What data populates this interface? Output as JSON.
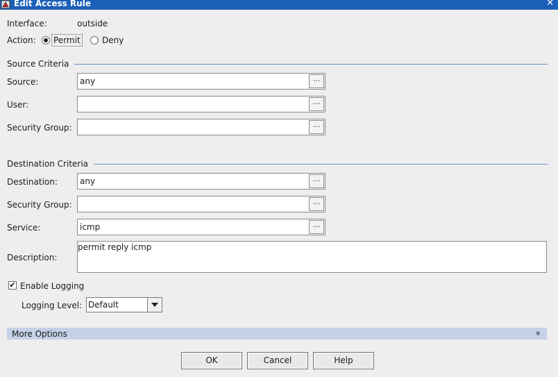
{
  "window": {
    "title": "Edit Access Rule"
  },
  "interface": {
    "label": "Interface:",
    "value": "outside"
  },
  "action": {
    "label": "Action:",
    "permit": "Permit",
    "deny": "Deny"
  },
  "source_criteria": {
    "heading": "Source Criteria",
    "source_label": "Source:",
    "source_value": "any",
    "user_label": "User:",
    "user_value": "",
    "sg_label": "Security Group:",
    "sg_value": ""
  },
  "destination_criteria": {
    "heading": "Destination Criteria",
    "destination_label": "Destination:",
    "destination_value": "any",
    "sg_label": "Security Group:",
    "sg_value": "",
    "service_label": "Service:",
    "service_value": "icmp"
  },
  "browse_label": "...",
  "description": {
    "label": "Description:",
    "value": "permit reply icmp"
  },
  "logging": {
    "enable_label": "Enable Logging",
    "checked_mark": "✔",
    "level_label": "Logging Level:",
    "level_value": "Default"
  },
  "more_options": {
    "label": "More Options",
    "chevron": "»"
  },
  "buttons": {
    "ok": "OK",
    "cancel": "Cancel",
    "help": "Help"
  },
  "colors": {
    "titlebar": "#1b5fb8",
    "section_line": "#6a8fc7",
    "more_options_bg": "#c4d1e6"
  }
}
